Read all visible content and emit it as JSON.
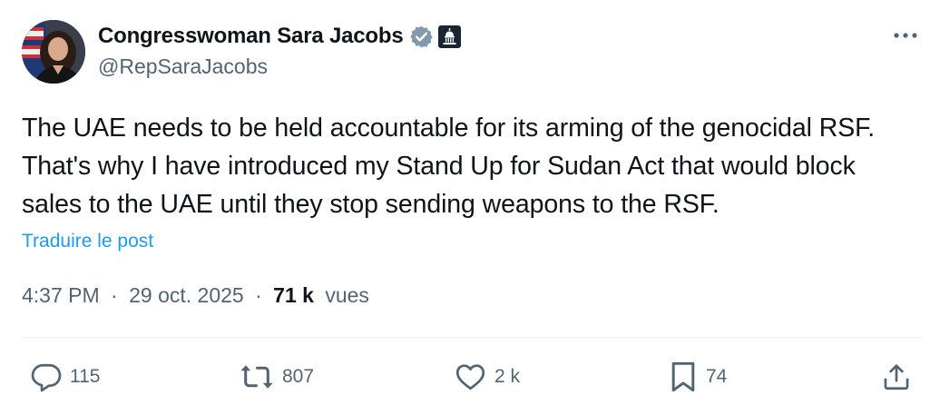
{
  "author": {
    "display_name": "Congresswoman Sara Jacobs",
    "handle": "@RepSaraJacobs"
  },
  "tweet": {
    "text": "The UAE needs to be held accountable for its arming of the genocidal RSF. That's why I have introduced my Stand Up for Sudan Act that would block sales to the UAE until they stop sending weapons to the RSF.",
    "translate_label": "Traduire le post"
  },
  "meta": {
    "time": "4:37 PM",
    "separator": "·",
    "date": "29 oct. 2025",
    "views_count": "71 k",
    "views_label": "vues"
  },
  "actions": {
    "replies": "115",
    "reposts": "807",
    "likes": "2 k",
    "bookmarks": "74"
  },
  "icons": {
    "verified": "verified-badge-icon",
    "affiliation": "capitol-icon",
    "more": "more-icon",
    "reply": "reply-icon",
    "repost": "repost-icon",
    "like": "heart-icon",
    "bookmark": "bookmark-icon",
    "share": "share-icon"
  },
  "colors": {
    "text": "#0f1419",
    "secondary": "#536471",
    "link": "#1d9bf0",
    "verified_gray": "#829aab",
    "divider": "#eff3f4"
  }
}
